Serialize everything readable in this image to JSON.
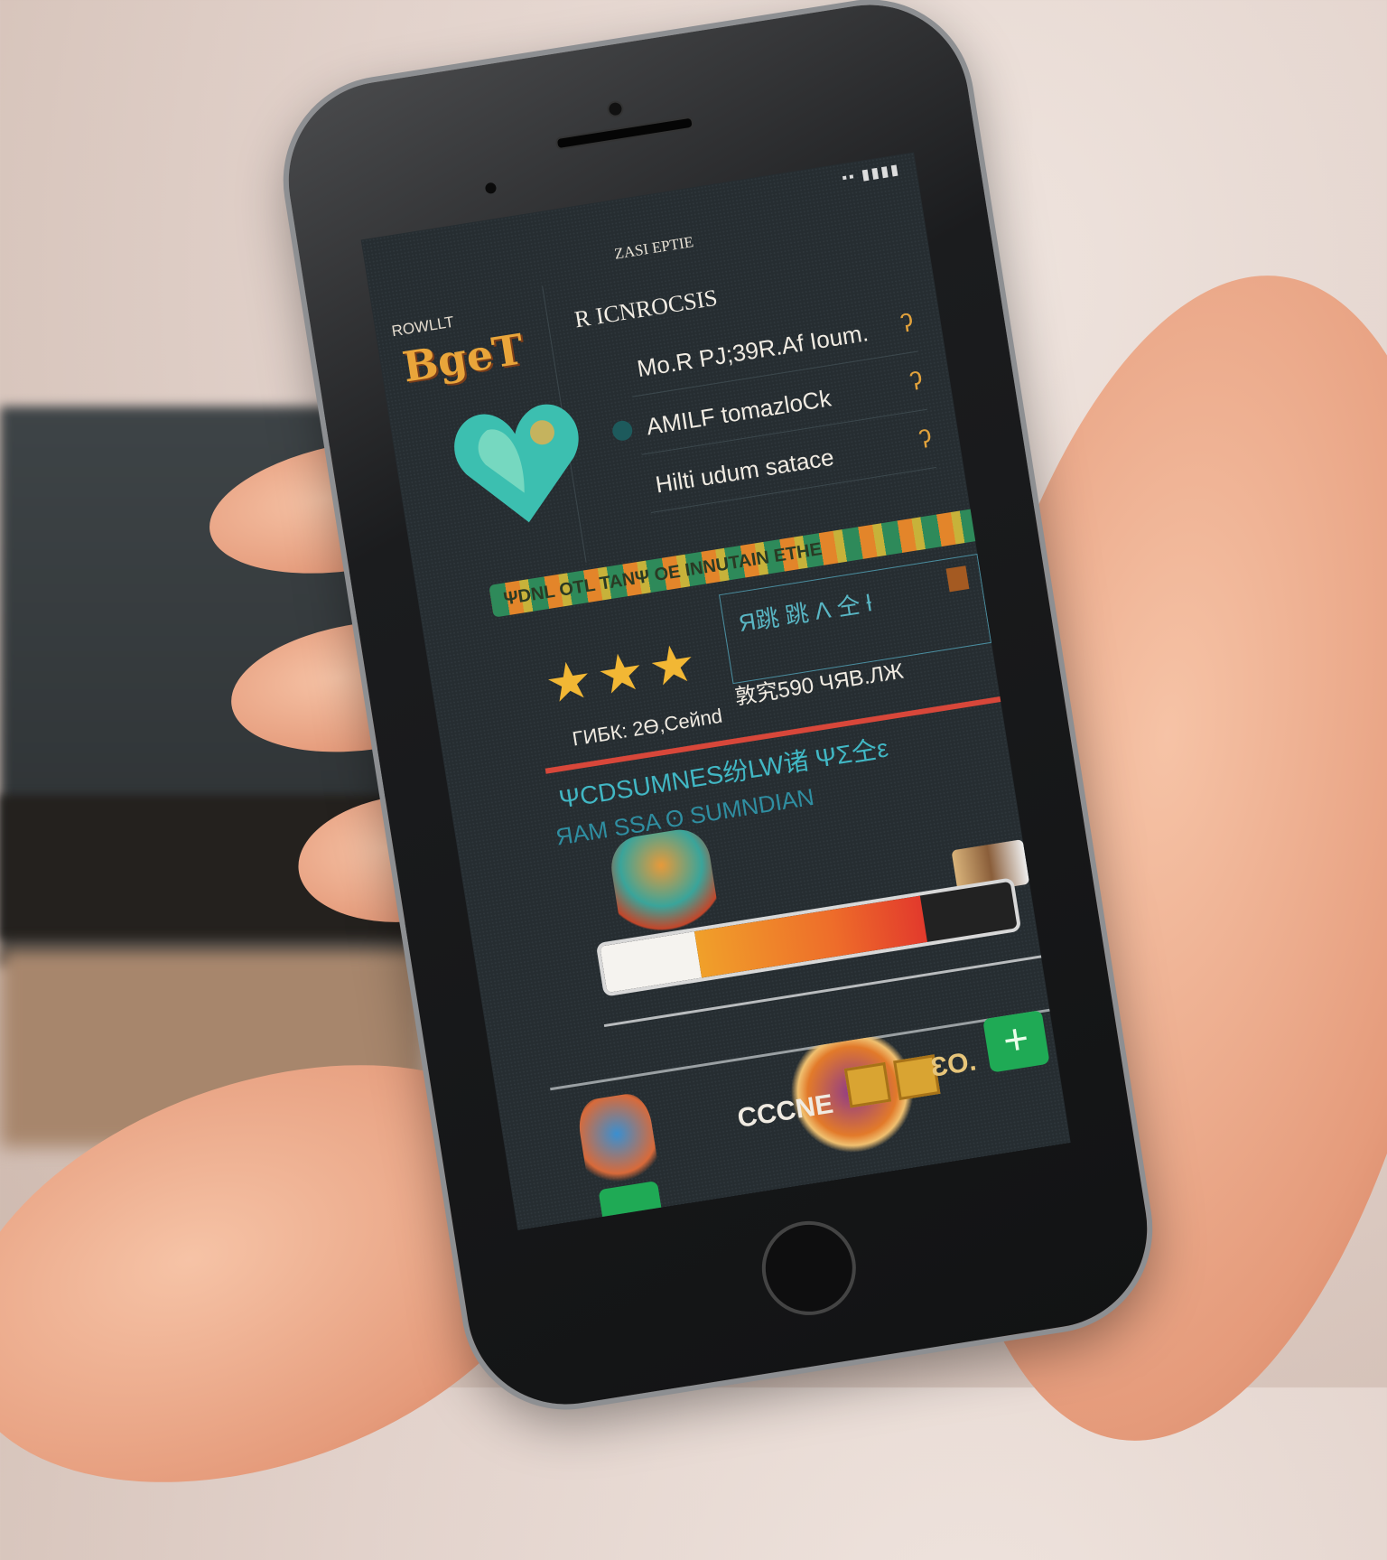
{
  "status_bar": {
    "indicators": "▪▪ ▮▮▮▮"
  },
  "header": {
    "top_label": "ZASI EPTIE",
    "corner_label": "ROWLLT",
    "logo_text": "BgeT",
    "title": "R ICNROCSIS"
  },
  "icons": {
    "heart": "heart-icon",
    "stars": "star-icon",
    "add": "plus-icon"
  },
  "menu": {
    "items": [
      {
        "label": "Mo.R PJ;39R.Af Ioum.",
        "icon": "ʔ"
      },
      {
        "label": "AMILF  tomazloCk",
        "icon": "ʔ"
      },
      {
        "label": "Hilti udum satace",
        "icon": "ʔ"
      }
    ]
  },
  "banner": {
    "text": "ΨDNL OTL TANΨ OE INNUTAIN ETHE"
  },
  "rating": {
    "stars": 3,
    "meta": "ΓИБК: 2Ө,Ceйnd"
  },
  "info_box": {
    "text": "Я跳 跳 Ʌ 仝 ƚ",
    "score": "敦究590 ЧЯВ.ЛЖ"
  },
  "teal_lines": [
    "ΨCDSUMNES纷LW诸 ΨΣ仝ε",
    "ЯAM SSA ʘ SUMNDIAN"
  ],
  "health": {
    "white_fraction": 0.23,
    "fill_fraction": 0.55
  },
  "bottom": {
    "label": "CCCNE",
    "gold_text": "ƐO.",
    "add_symbol": "+"
  },
  "colors": {
    "screen_bg": "#262d31",
    "accent_gold": "#e9a53a",
    "teal": "#41b7c4",
    "red": "#d8473a",
    "green": "#1faa55"
  }
}
